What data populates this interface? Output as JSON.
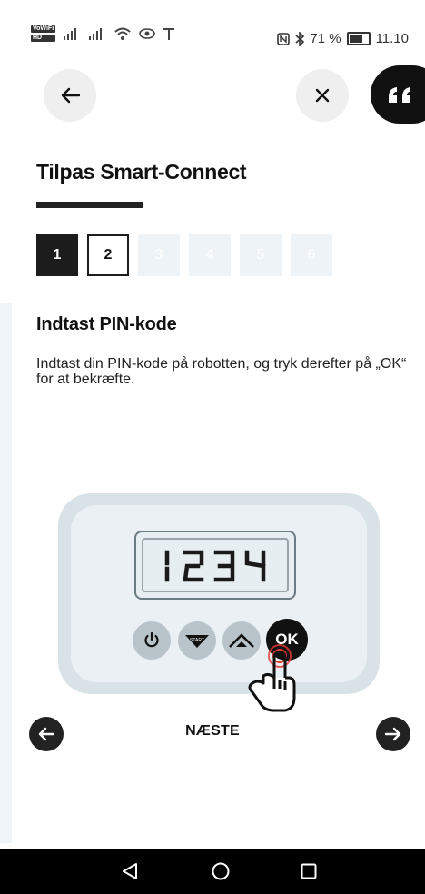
{
  "status_bar": {
    "badge_top": "VoWiFi",
    "badge_bottom": "HD",
    "battery_text": "71 %",
    "time": "11.10"
  },
  "header": {
    "back_icon": "arrow-left-icon",
    "close_icon": "close-icon",
    "feedback_icon": "quote-icon"
  },
  "title": "Tilpas Smart-Connect",
  "steps": [
    {
      "label": "1",
      "state": "done"
    },
    {
      "label": "2",
      "state": "current"
    },
    {
      "label": "3",
      "state": "todo"
    },
    {
      "label": "4",
      "state": "todo"
    },
    {
      "label": "5",
      "state": "todo"
    },
    {
      "label": "6",
      "state": "todo"
    }
  ],
  "section": {
    "heading": "Indtast PIN-kode",
    "text": "Indtast din PIN-kode på robotten, og tryk derefter på „OK“ for at bekræfte."
  },
  "illustration": {
    "display_digits": "1234",
    "start_label": "START",
    "ok_label": "OK"
  },
  "footer": {
    "next_label": "NÆSTE"
  },
  "colors": {
    "dark": "#111111",
    "step_todo": "#eef3f7",
    "device_outer": "#d9e3e7",
    "device_inner": "#eaf0f3",
    "control_grey": "#b8c4c9",
    "tap_red": "#e53935"
  }
}
